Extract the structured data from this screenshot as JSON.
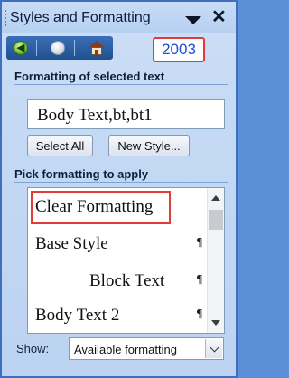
{
  "window": {
    "title": "Styles and Formatting",
    "menu_icon": "dropdown-triangle-icon",
    "close_label": "✕"
  },
  "toolbar": {
    "back_icon": "back-arrow-icon",
    "back_glyph": "◀",
    "forward_icon": "forward-arrow-icon",
    "home_icon": "home-icon"
  },
  "version_badge": "2003",
  "selected_section": {
    "label": "Formatting of selected text",
    "current_style": "Body Text,bt,bt1",
    "select_all_label": "Select All",
    "new_style_label": "New Style..."
  },
  "pick_section": {
    "label": "Pick formatting to apply",
    "items": [
      {
        "label": "Clear Formatting",
        "mark": ""
      },
      {
        "label": "Base Style",
        "mark": "¶"
      },
      {
        "label": "Block Text",
        "mark": "¶"
      },
      {
        "label": "Body Text 2",
        "mark": "¶"
      }
    ]
  },
  "show": {
    "label": "Show:",
    "value": "Available formatting"
  }
}
